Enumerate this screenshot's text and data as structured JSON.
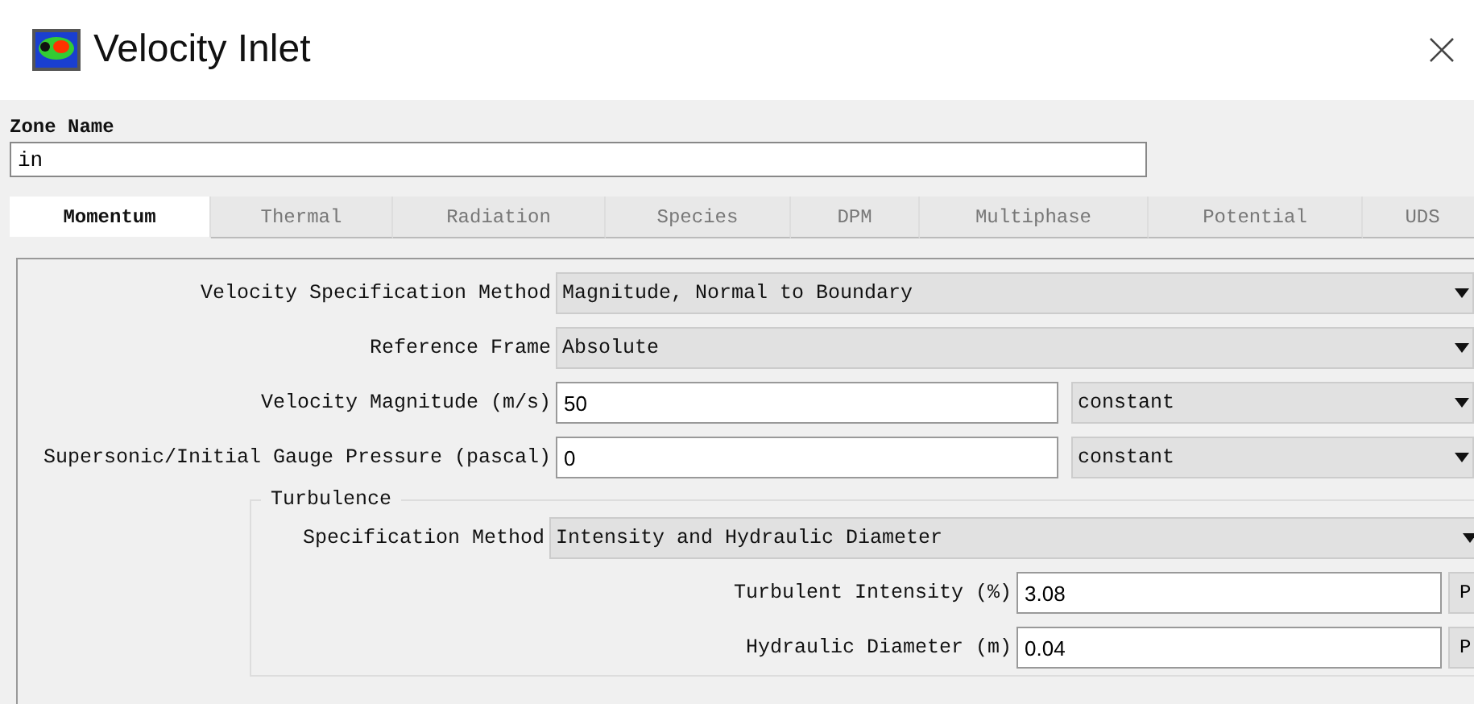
{
  "window": {
    "title": "Velocity Inlet"
  },
  "zone": {
    "label": "Zone Name",
    "value": "in"
  },
  "tabs": [
    {
      "label": "Momentum",
      "selected": true
    },
    {
      "label": "Thermal",
      "selected": false
    },
    {
      "label": "Radiation",
      "selected": false
    },
    {
      "label": "Species",
      "selected": false
    },
    {
      "label": "DPM",
      "selected": false
    },
    {
      "label": "Multiphase",
      "selected": false
    },
    {
      "label": "Potential",
      "selected": false
    },
    {
      "label": "UDS",
      "selected": false
    }
  ],
  "fields": [
    {
      "kind": "dropdown",
      "label": "Velocity Specification Method",
      "value": "Magnitude, Normal to Boundary"
    },
    {
      "kind": "dropdown",
      "label": "Reference Frame",
      "value": "Absolute"
    },
    {
      "kind": "profile",
      "label": "Velocity Magnitude (m/s)",
      "value": "50",
      "option": "constant"
    },
    {
      "kind": "profile",
      "label": "Supersonic/Initial Gauge Pressure (pascal)",
      "value": "0",
      "option": "constant"
    }
  ],
  "turbulence": {
    "title": "Turbulence",
    "fields": [
      {
        "kind": "dropdown",
        "label": "Specification Method",
        "value": "Intensity and Hydraulic Diameter"
      },
      {
        "kind": "parameter",
        "label": "Turbulent Intensity (%)",
        "value": "3.08",
        "button": "P"
      },
      {
        "kind": "parameter",
        "label": "Hydraulic Diameter (m)",
        "value": "0.04",
        "button": "P"
      }
    ]
  }
}
